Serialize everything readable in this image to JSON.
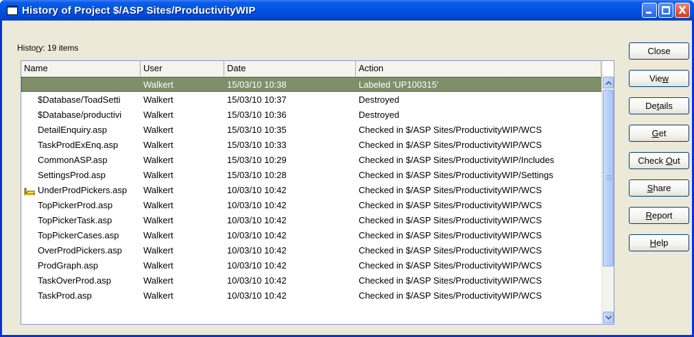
{
  "window": {
    "title": "History of Project $/ASP Sites/ProductivityWIP",
    "title_controls": [
      "minimize-icon",
      "maximize-icon",
      "close-icon"
    ],
    "close_glyph": "X"
  },
  "history": {
    "label_prefix": "Histo",
    "label_accel": "r",
    "label_suffix": "y: 19 items"
  },
  "columns": {
    "name": "Name",
    "user": "User",
    "date": "Date",
    "action": "Action"
  },
  "rows": [
    {
      "name": "",
      "user": "Walkert",
      "date": "15/03/10 10:38",
      "action": "Labeled 'UP100315'",
      "icon": "label-icon",
      "selected": true
    },
    {
      "name": "$Database/ToadSetti",
      "user": "Walkert",
      "date": "15/03/10 10:37",
      "action": "Destroyed"
    },
    {
      "name": "$Database/productivi",
      "user": "Walkert",
      "date": "15/03/10 10:36",
      "action": "Destroyed"
    },
    {
      "name": "DetailEnquiry.asp",
      "user": "Walkert",
      "date": "15/03/10 10:35",
      "action": "Checked in $/ASP Sites/ProductivityWIP/WCS"
    },
    {
      "name": "TaskProdExEnq.asp",
      "user": "Walkert",
      "date": "15/03/10 10:33",
      "action": "Checked in $/ASP Sites/ProductivityWIP/WCS"
    },
    {
      "name": "CommonASP.asp",
      "user": "Walkert",
      "date": "15/03/10 10:29",
      "action": "Checked in $/ASP Sites/ProductivityWIP/Includes"
    },
    {
      "name": "SettingsProd.asp",
      "user": "Walkert",
      "date": "15/03/10 10:28",
      "action": "Checked in $/ASP Sites/ProductivityWIP/Settings"
    },
    {
      "name": "UnderProdPickers.asp",
      "user": "Walkert",
      "date": "10/03/10 10:42",
      "action": "Checked in $/ASP Sites/ProductivityWIP/WCS",
      "icon": "label-icon"
    },
    {
      "name": "TopPickerProd.asp",
      "user": "Walkert",
      "date": "10/03/10 10:42",
      "action": "Checked in $/ASP Sites/ProductivityWIP/WCS"
    },
    {
      "name": "TopPickerTask.asp",
      "user": "Walkert",
      "date": "10/03/10 10:42",
      "action": "Checked in $/ASP Sites/ProductivityWIP/WCS"
    },
    {
      "name": "TopPickerCases.asp",
      "user": "Walkert",
      "date": "10/03/10 10:42",
      "action": "Checked in $/ASP Sites/ProductivityWIP/WCS"
    },
    {
      "name": "OverProdPickers.asp",
      "user": "Walkert",
      "date": "10/03/10 10:42",
      "action": "Checked in $/ASP Sites/ProductivityWIP/WCS"
    },
    {
      "name": "ProdGraph.asp",
      "user": "Walkert",
      "date": "10/03/10 10:42",
      "action": "Checked in $/ASP Sites/ProductivityWIP/WCS"
    },
    {
      "name": "TaskOverProd.asp",
      "user": "Walkert",
      "date": "10/03/10 10:42",
      "action": "Checked in $/ASP Sites/ProductivityWIP/WCS"
    },
    {
      "name": "TaskProd.asp",
      "user": "Walkert",
      "date": "10/03/10 10:42",
      "action": "Checked in $/ASP Sites/ProductivityWIP/WCS"
    }
  ],
  "buttons": [
    {
      "name": "close-button",
      "pre": "Close",
      "accel": "",
      "post": ""
    },
    {
      "name": "view-button",
      "pre": "Vie",
      "accel": "w",
      "post": ""
    },
    {
      "name": "details-button",
      "pre": "De",
      "accel": "t",
      "post": "ails"
    },
    {
      "name": "get-button",
      "pre": "",
      "accel": "G",
      "post": "et"
    },
    {
      "name": "check-out-button",
      "pre": "Check ",
      "accel": "O",
      "post": "ut"
    },
    {
      "name": "share-button",
      "pre": "",
      "accel": "S",
      "post": "hare"
    },
    {
      "name": "report-button",
      "pre": "",
      "accel": "R",
      "post": "eport"
    },
    {
      "name": "help-button",
      "pre": "",
      "accel": "H",
      "post": "elp"
    }
  ],
  "colors": {
    "titlebar": "#0054e3",
    "selection": "#7f8f6a",
    "window_bg": "#ece9d8"
  }
}
